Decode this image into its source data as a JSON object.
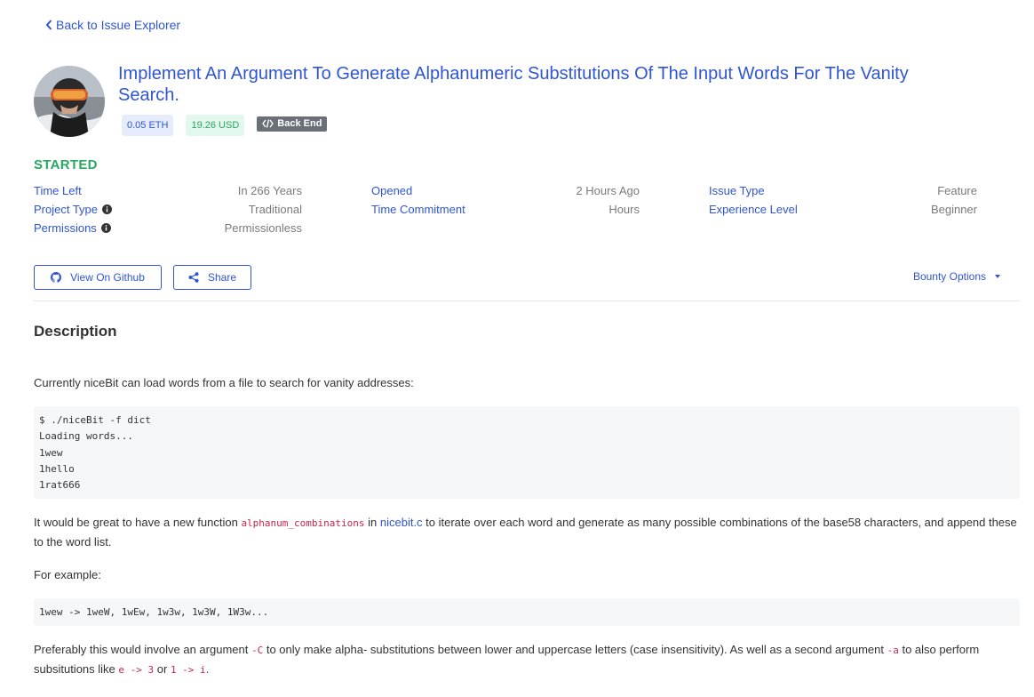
{
  "nav": {
    "back_label": "Back to Issue Explorer"
  },
  "issue": {
    "title": "Implement An Argument To Generate Alphanumeric Substitutions Of The Input Words For The Vanity Search.",
    "amount_eth": "0.05 ETH",
    "amount_usd": "19.26 USD",
    "category": "Back End",
    "status": "STARTED"
  },
  "meta": {
    "col1": [
      {
        "label": "Time Left",
        "value": "In 266 Years",
        "info": false
      },
      {
        "label": "Project Type",
        "value": "Traditional",
        "info": true
      },
      {
        "label": "Permissions",
        "value": "Permissionless",
        "info": true
      }
    ],
    "col2": [
      {
        "label": "Opened",
        "value": "2 Hours Ago"
      },
      {
        "label": "Time Commitment",
        "value": "Hours"
      }
    ],
    "col3": [
      {
        "label": "Issue Type",
        "value": "Feature"
      },
      {
        "label": "Experience Level",
        "value": "Beginner"
      }
    ]
  },
  "actions": {
    "github_label": "View On Github",
    "share_label": "Share",
    "bounty_options_label": "Bounty Options"
  },
  "description": {
    "heading": "Description",
    "intro": "Currently niceBit can load words from a file to search for vanity addresses:",
    "code1": "$ ./niceBit -f dict\nLoading words...\n1wew\n1hello\n1rat666",
    "p2_before": "It would be great to have a new function ",
    "p2_code": "alphanum_combinations",
    "p2_mid": " in ",
    "p2_link": "nicebit.c",
    "p2_after": " to iterate over each word and generate as many possible combinations of the base58 characters, and append these to the word list.",
    "example_label": "For example:",
    "code2": "1wew -> 1weW, 1wEw, 1w3w, 1w3W, 1W3w...",
    "p3_before": "Preferably this would involve an argument ",
    "p3_code1": "-C",
    "p3_mid1": " to only make alpha- substitutions between lower and uppercase letters (case insensitivity). As well as a second argument ",
    "p3_code2": "-a",
    "p3_mid2": " to also perform subsitutions like ",
    "p3_code3": "e -> 3",
    "p3_or": " or ",
    "p3_code4": "1 -> i",
    "p3_end": "."
  },
  "colors": {
    "accent": "#2f55d4",
    "status_green": "#2aa760",
    "code_red": "#c7254e"
  },
  "icons": {
    "back": "chevron-left-icon",
    "category": "code-icon",
    "github": "github-icon",
    "share": "share-icon",
    "info": "info-circle-icon"
  }
}
